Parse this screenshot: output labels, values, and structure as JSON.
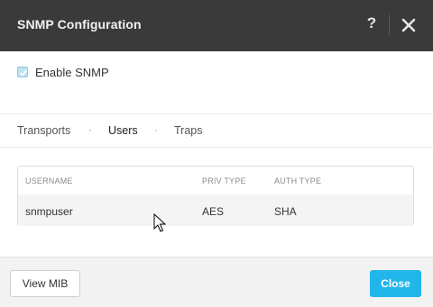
{
  "dialog": {
    "title": "SNMP Configuration",
    "help_label": "?"
  },
  "enable": {
    "label": "Enable SNMP",
    "checked": true
  },
  "tabs": [
    {
      "label": "Transports",
      "active": false
    },
    {
      "label": "Users",
      "active": true
    },
    {
      "label": "Traps",
      "active": false
    }
  ],
  "table": {
    "columns": [
      "USERNAME",
      "PRIV TYPE",
      "AUTH TYPE"
    ],
    "rows": [
      [
        "snmpuser",
        "AES",
        "SHA"
      ]
    ]
  },
  "footer": {
    "view_mib_label": "View MIB",
    "close_label": "Close"
  },
  "colors": {
    "header_bg": "#3a3a3a",
    "accent": "#22b5ea",
    "checkbox": "#bfe3f2"
  }
}
